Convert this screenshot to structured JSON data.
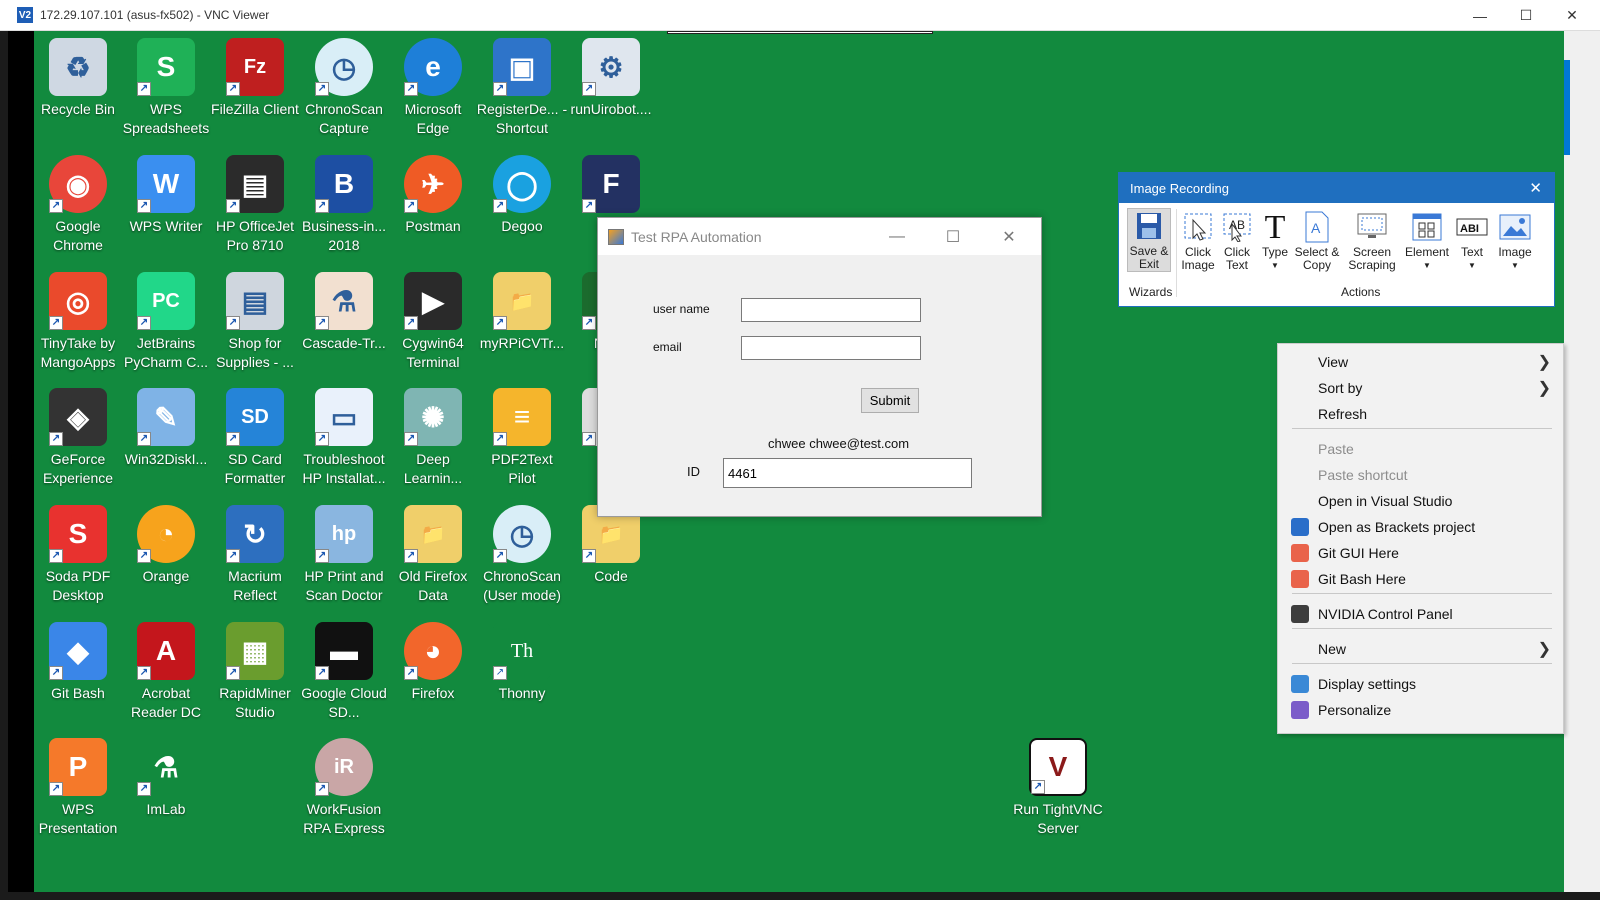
{
  "vnc": {
    "title": "172.29.107.101 (asus-fx502) - VNC Viewer",
    "logo": "V2",
    "minimize": "—",
    "maximize": "☐",
    "close": "✕"
  },
  "desktop_icons": [
    {
      "id": "recycle-bin",
      "label": "Recycle Bin",
      "icon": "recycle-bin-icon",
      "color": "#cfd8e3",
      "glyph": "♻"
    },
    {
      "id": "wps-spreadsheets",
      "label": "WPS Spreadsheets",
      "icon": "wps-spreadsheets-icon",
      "color": "#1fb157",
      "glyph": "S"
    },
    {
      "id": "filezilla",
      "label": "FileZilla Client",
      "icon": "filezilla-icon",
      "color": "#bf1f1f",
      "glyph": "Fz"
    },
    {
      "id": "chronoscan-capture",
      "label": "ChronoScan Capture",
      "icon": "chronoscan-icon",
      "color": "#d9eef7",
      "glyph": "◷"
    },
    {
      "id": "microsoft-edge",
      "label": "Microsoft Edge",
      "icon": "edge-icon",
      "color": "#1e7fd8",
      "glyph": "e"
    },
    {
      "id": "registerde",
      "label": "RegisterDe... - Shortcut",
      "icon": "shortcut-window-icon",
      "color": "#2e74c9",
      "glyph": "▣"
    },
    {
      "id": "runuirobot",
      "label": "runUirobot....",
      "icon": "gears-icon",
      "color": "#dfe6ee",
      "glyph": "⚙"
    },
    {
      "id": "google-chrome",
      "label": "Google Chrome",
      "icon": "chrome-icon",
      "color": "#e8463a",
      "glyph": "◉"
    },
    {
      "id": "wps-writer",
      "label": "WPS Writer",
      "icon": "wps-writer-icon",
      "color": "#3a8ff0",
      "glyph": "W"
    },
    {
      "id": "hp-officejet",
      "label": "HP OfficeJet Pro 8710",
      "icon": "printer-icon",
      "color": "#2b2b2b",
      "glyph": "▤"
    },
    {
      "id": "business-in",
      "label": "Business-in... 2018",
      "icon": "business-icon",
      "color": "#1d4fa3",
      "glyph": "B"
    },
    {
      "id": "postman",
      "label": "Postman",
      "icon": "postman-icon",
      "color": "#ef5b25",
      "glyph": "✈"
    },
    {
      "id": "degoo",
      "label": "Degoo",
      "icon": "degoo-icon",
      "color": "#1aa1e0",
      "glyph": "◯"
    },
    {
      "id": "pdf",
      "label": "PDF",
      "icon": "pdf-app-icon",
      "color": "#233162",
      "glyph": "F"
    },
    {
      "id": "tinytake",
      "label": "TinyTake by MangoApps",
      "icon": "tinytake-icon",
      "color": "#ea4a2c",
      "glyph": "◎"
    },
    {
      "id": "pycharm",
      "label": "JetBrains PyCharm C...",
      "icon": "pycharm-icon",
      "color": "#21d789",
      "glyph": "PC"
    },
    {
      "id": "shop-supplies",
      "label": "Shop for Supplies - ...",
      "icon": "printer-shop-icon",
      "color": "#cfd6de",
      "glyph": "▤"
    },
    {
      "id": "cascade",
      "label": "Cascade-Tr...",
      "icon": "flask-icon",
      "color": "#f2e0d0",
      "glyph": "⚗"
    },
    {
      "id": "cygwin",
      "label": "Cygwin64 Terminal",
      "icon": "terminal-icon",
      "color": "#2a2a2a",
      "glyph": "▶"
    },
    {
      "id": "myrpicvtr",
      "label": "myRPiCVTr...",
      "icon": "folder-icon",
      "color": "#f0cf6a",
      "glyph": "📁"
    },
    {
      "id": "nsi",
      "label": "N Nsi",
      "icon": "nsi-icon",
      "color": "#1b6b2d",
      "glyph": "●"
    },
    {
      "id": "geforce",
      "label": "GeForce Experience",
      "icon": "geforce-icon",
      "color": "#333",
      "glyph": "◈"
    },
    {
      "id": "win32diski",
      "label": "Win32DiskI...",
      "icon": "disk-imager-icon",
      "color": "#7fb3e6",
      "glyph": "✎"
    },
    {
      "id": "sd-formatter",
      "label": "SD Card Formatter",
      "icon": "sd-card-icon",
      "color": "#2584d8",
      "glyph": "SD"
    },
    {
      "id": "troubleshoot-hp",
      "label": "Troubleshoot HP Installat...",
      "icon": "troubleshoot-icon",
      "color": "#e9f1fb",
      "glyph": "▭"
    },
    {
      "id": "deep-learning",
      "label": "Deep Learnin...",
      "icon": "network-icon",
      "color": "#7fb5b3",
      "glyph": "✺"
    },
    {
      "id": "pdf2text",
      "label": "PDF2Text Pilot",
      "icon": "pdf2text-icon",
      "color": "#f5b52c",
      "glyph": "≡"
    },
    {
      "id": "sna",
      "label": "sna",
      "icon": "sna-icon",
      "color": "#ddd",
      "glyph": "▯"
    },
    {
      "id": "soda-pdf",
      "label": "Soda PDF Desktop",
      "icon": "soda-pdf-icon",
      "color": "#e8322f",
      "glyph": "S"
    },
    {
      "id": "orange",
      "label": "Orange",
      "icon": "orange-icon",
      "color": "#f7a31c",
      "glyph": "◔"
    },
    {
      "id": "macrium",
      "label": "Macrium Reflect",
      "icon": "macrium-icon",
      "color": "#2d6fbf",
      "glyph": "↻"
    },
    {
      "id": "hp-print-scan",
      "label": "HP Print and Scan Doctor",
      "icon": "hp-doctor-icon",
      "color": "#8ab6e0",
      "glyph": "hp"
    },
    {
      "id": "old-firefox",
      "label": "Old Firefox Data",
      "icon": "folder-icon",
      "color": "#f0cf6a",
      "glyph": "📁"
    },
    {
      "id": "chronoscan-user",
      "label": "ChronoScan (User mode)",
      "icon": "chronoscan-icon",
      "color": "#d9eef7",
      "glyph": "◷"
    },
    {
      "id": "code",
      "label": "Code",
      "icon": "folder-icon",
      "color": "#f0cf6a",
      "glyph": "📁"
    },
    {
      "id": "git-bash",
      "label": "Git Bash",
      "icon": "git-bash-icon",
      "color": "#3a86e8",
      "glyph": "◆"
    },
    {
      "id": "acrobat",
      "label": "Acrobat Reader DC",
      "icon": "acrobat-icon",
      "color": "#c4161c",
      "glyph": "A"
    },
    {
      "id": "rapidminer",
      "label": "RapidMiner Studio",
      "icon": "rapidminer-icon",
      "color": "#6a9d2e",
      "glyph": "▦"
    },
    {
      "id": "google-cloud-sdk",
      "label": "Google Cloud SD...",
      "icon": "cloud-sdk-icon",
      "color": "#111",
      "glyph": "▬"
    },
    {
      "id": "firefox",
      "label": "Firefox",
      "icon": "firefox-icon",
      "color": "#f2662b",
      "glyph": "◕"
    },
    {
      "id": "thonny",
      "label": "Thonny",
      "icon": "thonny-icon",
      "color": "#128a3e",
      "glyph": "Th"
    },
    {
      "id": "wps-presentation",
      "label": "WPS Presentation",
      "icon": "wps-presentation-icon",
      "color": "#f5792a",
      "glyph": "P"
    },
    {
      "id": "imlab",
      "label": "ImLab",
      "icon": "imlab-icon",
      "color": "#128a3e",
      "glyph": "⚗"
    },
    {
      "id": "workfusion",
      "label": "WorkFusion RPA Express",
      "icon": "workfusion-icon",
      "color": "#c9a6a6",
      "glyph": "iR"
    },
    {
      "id": "run-tightvnc",
      "label": "Run TightVNC Server",
      "icon": "tightvnc-icon",
      "color": "#fff",
      "glyph": "V"
    }
  ],
  "test_window": {
    "title": "Test RPA Automation",
    "minimize": "—",
    "maximize": "☐",
    "close": "✕",
    "username_label": "user name",
    "username_value": "",
    "email_label": "email",
    "email_value": "",
    "submit_label": "Submit",
    "result_text": "chwee chwee@test.com",
    "id_label": "ID",
    "id_value": "4461"
  },
  "image_recording": {
    "title": "Image Recording",
    "close": "✕",
    "tools": [
      {
        "id": "save-exit",
        "label": "Save & Exit"
      },
      {
        "id": "click-image",
        "label": "Click Image"
      },
      {
        "id": "click-text",
        "label": "Click Text"
      },
      {
        "id": "type",
        "label": "Type"
      },
      {
        "id": "select-copy",
        "label": "Select & Copy"
      },
      {
        "id": "screen-scraping",
        "label": "Screen Scraping"
      },
      {
        "id": "element",
        "label": "Element"
      },
      {
        "id": "text",
        "label": "Text"
      },
      {
        "id": "image",
        "label": "Image"
      }
    ],
    "group_wizards": "Wizards",
    "group_actions": "Actions"
  },
  "context_menu": {
    "items": [
      {
        "id": "view",
        "label": "View",
        "disabled": false,
        "submenu": true
      },
      {
        "id": "sort-by",
        "label": "Sort by",
        "disabled": false,
        "submenu": true
      },
      {
        "id": "refresh",
        "label": "Refresh",
        "disabled": false,
        "submenu": false
      },
      {
        "id": "paste",
        "label": "Paste",
        "disabled": true,
        "submenu": false
      },
      {
        "id": "paste-shortcut",
        "label": "Paste shortcut",
        "disabled": true,
        "submenu": false
      },
      {
        "id": "open-visual-studio",
        "label": "Open in Visual Studio",
        "disabled": false,
        "submenu": false
      },
      {
        "id": "open-brackets",
        "label": "Open as Brackets project",
        "disabled": false,
        "submenu": false,
        "icon": "brackets-icon"
      },
      {
        "id": "git-gui",
        "label": "Git GUI Here",
        "disabled": false,
        "submenu": false,
        "icon": "git-icon"
      },
      {
        "id": "git-bash-here",
        "label": "Git Bash Here",
        "disabled": false,
        "submenu": false,
        "icon": "git-icon"
      },
      {
        "id": "nvidia",
        "label": "NVIDIA Control Panel",
        "disabled": false,
        "submenu": false,
        "icon": "nvidia-icon"
      },
      {
        "id": "new",
        "label": "New",
        "disabled": false,
        "submenu": true
      },
      {
        "id": "display-settings",
        "label": "Display settings",
        "disabled": false,
        "submenu": false,
        "icon": "display-icon"
      },
      {
        "id": "personalize",
        "label": "Personalize",
        "disabled": false,
        "submenu": false,
        "icon": "personalize-icon"
      }
    ],
    "chevron": "❯"
  },
  "colors": {
    "desktop": "#128a3e",
    "accent": "#1f6fbf"
  }
}
